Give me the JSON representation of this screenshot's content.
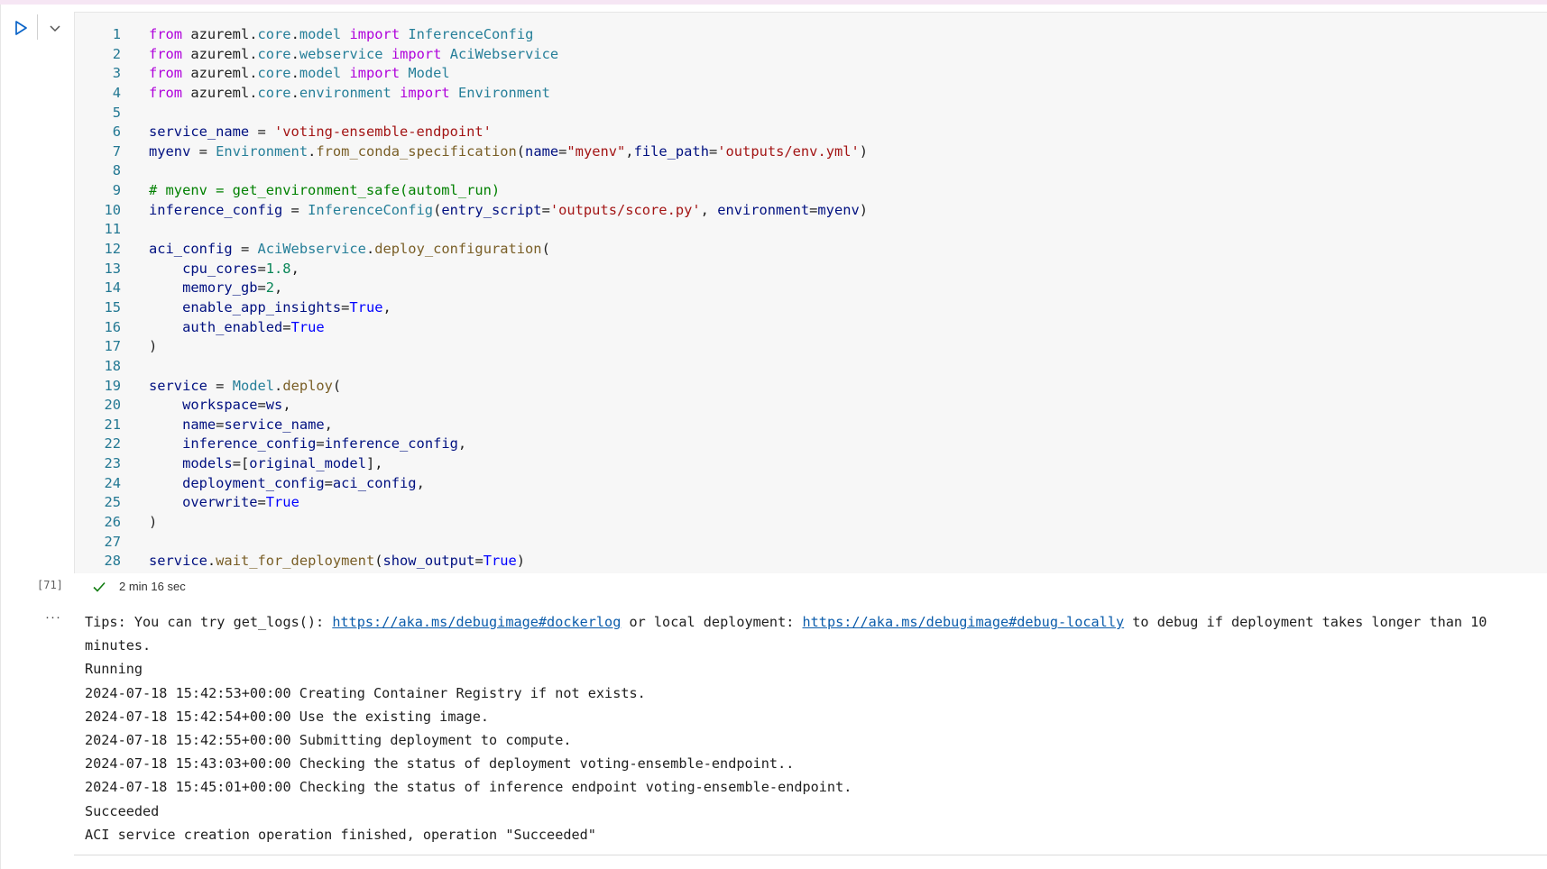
{
  "cell": {
    "execution_count": "[71]",
    "status": "succeeded",
    "duration": "2 min 16 sec",
    "icons": {
      "run": "run-triangle-icon",
      "expand": "chevron-down-icon",
      "status": "check-icon",
      "output_menu": "ellipsis-icon"
    },
    "code_lines": [
      {
        "n": "1",
        "tokens": [
          {
            "t": "from",
            "c": "k"
          },
          {
            "t": " azureml",
            "c": ""
          },
          {
            "t": ".",
            "c": ""
          },
          {
            "t": "core",
            "c": "m"
          },
          {
            "t": ".",
            "c": ""
          },
          {
            "t": "model",
            "c": "m"
          },
          {
            "t": " ",
            "c": ""
          },
          {
            "t": "import",
            "c": "k"
          },
          {
            "t": " InferenceConfig",
            "c": "t"
          }
        ]
      },
      {
        "n": "2",
        "tokens": [
          {
            "t": "from",
            "c": "k"
          },
          {
            "t": " azureml",
            "c": ""
          },
          {
            "t": ".",
            "c": ""
          },
          {
            "t": "core",
            "c": "m"
          },
          {
            "t": ".",
            "c": ""
          },
          {
            "t": "webservice",
            "c": "m"
          },
          {
            "t": " ",
            "c": ""
          },
          {
            "t": "import",
            "c": "k"
          },
          {
            "t": " AciWebservice",
            "c": "t"
          }
        ]
      },
      {
        "n": "3",
        "tokens": [
          {
            "t": "from",
            "c": "k"
          },
          {
            "t": " azureml",
            "c": ""
          },
          {
            "t": ".",
            "c": ""
          },
          {
            "t": "core",
            "c": "m"
          },
          {
            "t": ".",
            "c": ""
          },
          {
            "t": "model",
            "c": "m"
          },
          {
            "t": " ",
            "c": ""
          },
          {
            "t": "import",
            "c": "k"
          },
          {
            "t": " Model",
            "c": "t"
          }
        ]
      },
      {
        "n": "4",
        "tokens": [
          {
            "t": "from",
            "c": "k"
          },
          {
            "t": " azureml",
            "c": ""
          },
          {
            "t": ".",
            "c": ""
          },
          {
            "t": "core",
            "c": "m"
          },
          {
            "t": ".",
            "c": ""
          },
          {
            "t": "environment",
            "c": "m"
          },
          {
            "t": " ",
            "c": ""
          },
          {
            "t": "import",
            "c": "k"
          },
          {
            "t": " Environment",
            "c": "t"
          }
        ]
      },
      {
        "n": "5",
        "tokens": []
      },
      {
        "n": "6",
        "tokens": [
          {
            "t": "service_name",
            "c": "v"
          },
          {
            "t": " = ",
            "c": ""
          },
          {
            "t": "'voting-ensemble-endpoint'",
            "c": "s"
          }
        ]
      },
      {
        "n": "7",
        "tokens": [
          {
            "t": "myenv",
            "c": "v"
          },
          {
            "t": " = ",
            "c": ""
          },
          {
            "t": "Environment",
            "c": "t"
          },
          {
            "t": ".",
            "c": ""
          },
          {
            "t": "from_conda_specification",
            "c": "f"
          },
          {
            "t": "(",
            "c": ""
          },
          {
            "t": "name",
            "c": "v"
          },
          {
            "t": "=",
            "c": ""
          },
          {
            "t": "\"myenv\"",
            "c": "s"
          },
          {
            "t": ",",
            "c": ""
          },
          {
            "t": "file_path",
            "c": "v"
          },
          {
            "t": "=",
            "c": ""
          },
          {
            "t": "'outputs/env.yml'",
            "c": "s"
          },
          {
            "t": ")",
            "c": ""
          }
        ]
      },
      {
        "n": "8",
        "tokens": []
      },
      {
        "n": "9",
        "tokens": [
          {
            "t": "# myenv = get_environment_safe(automl_run)",
            "c": "c"
          }
        ]
      },
      {
        "n": "10",
        "tokens": [
          {
            "t": "inference_config",
            "c": "v"
          },
          {
            "t": " = ",
            "c": ""
          },
          {
            "t": "InferenceConfig",
            "c": "t"
          },
          {
            "t": "(",
            "c": ""
          },
          {
            "t": "entry_script",
            "c": "v"
          },
          {
            "t": "=",
            "c": ""
          },
          {
            "t": "'outputs/score.py'",
            "c": "s"
          },
          {
            "t": ", ",
            "c": ""
          },
          {
            "t": "environment",
            "c": "v"
          },
          {
            "t": "=",
            "c": ""
          },
          {
            "t": "myenv",
            "c": "v"
          },
          {
            "t": ")",
            "c": ""
          }
        ]
      },
      {
        "n": "11",
        "tokens": []
      },
      {
        "n": "12",
        "tokens": [
          {
            "t": "aci_config",
            "c": "v"
          },
          {
            "t": " = ",
            "c": ""
          },
          {
            "t": "AciWebservice",
            "c": "t"
          },
          {
            "t": ".",
            "c": ""
          },
          {
            "t": "deploy_configuration",
            "c": "f"
          },
          {
            "t": "(",
            "c": ""
          }
        ]
      },
      {
        "n": "13",
        "tokens": [
          {
            "t": "    ",
            "c": ""
          },
          {
            "t": "cpu_cores",
            "c": "v"
          },
          {
            "t": "=",
            "c": ""
          },
          {
            "t": "1.8",
            "c": "n"
          },
          {
            "t": ",",
            "c": ""
          }
        ]
      },
      {
        "n": "14",
        "tokens": [
          {
            "t": "    ",
            "c": ""
          },
          {
            "t": "memory_gb",
            "c": "v"
          },
          {
            "t": "=",
            "c": ""
          },
          {
            "t": "2",
            "c": "n"
          },
          {
            "t": ",",
            "c": ""
          }
        ]
      },
      {
        "n": "15",
        "tokens": [
          {
            "t": "    ",
            "c": ""
          },
          {
            "t": "enable_app_insights",
            "c": "v"
          },
          {
            "t": "=",
            "c": ""
          },
          {
            "t": "True",
            "c": "b"
          },
          {
            "t": ",",
            "c": ""
          }
        ]
      },
      {
        "n": "16",
        "tokens": [
          {
            "t": "    ",
            "c": ""
          },
          {
            "t": "auth_enabled",
            "c": "v"
          },
          {
            "t": "=",
            "c": ""
          },
          {
            "t": "True",
            "c": "b"
          }
        ]
      },
      {
        "n": "17",
        "tokens": [
          {
            "t": ")",
            "c": ""
          }
        ]
      },
      {
        "n": "18",
        "tokens": []
      },
      {
        "n": "19",
        "tokens": [
          {
            "t": "service",
            "c": "v"
          },
          {
            "t": " = ",
            "c": ""
          },
          {
            "t": "Model",
            "c": "t"
          },
          {
            "t": ".",
            "c": ""
          },
          {
            "t": "deploy",
            "c": "f"
          },
          {
            "t": "(",
            "c": ""
          }
        ]
      },
      {
        "n": "20",
        "tokens": [
          {
            "t": "    ",
            "c": ""
          },
          {
            "t": "workspace",
            "c": "v"
          },
          {
            "t": "=",
            "c": ""
          },
          {
            "t": "ws",
            "c": "v"
          },
          {
            "t": ",",
            "c": ""
          }
        ]
      },
      {
        "n": "21",
        "tokens": [
          {
            "t": "    ",
            "c": ""
          },
          {
            "t": "name",
            "c": "v"
          },
          {
            "t": "=",
            "c": ""
          },
          {
            "t": "service_name",
            "c": "v"
          },
          {
            "t": ",",
            "c": ""
          }
        ]
      },
      {
        "n": "22",
        "tokens": [
          {
            "t": "    ",
            "c": ""
          },
          {
            "t": "inference_config",
            "c": "v"
          },
          {
            "t": "=",
            "c": ""
          },
          {
            "t": "inference_config",
            "c": "v"
          },
          {
            "t": ",",
            "c": ""
          }
        ]
      },
      {
        "n": "23",
        "tokens": [
          {
            "t": "    ",
            "c": ""
          },
          {
            "t": "models",
            "c": "v"
          },
          {
            "t": "=[",
            "c": ""
          },
          {
            "t": "original_model",
            "c": "v"
          },
          {
            "t": "],",
            "c": ""
          }
        ]
      },
      {
        "n": "24",
        "tokens": [
          {
            "t": "    ",
            "c": ""
          },
          {
            "t": "deployment_config",
            "c": "v"
          },
          {
            "t": "=",
            "c": ""
          },
          {
            "t": "aci_config",
            "c": "v"
          },
          {
            "t": ",",
            "c": ""
          }
        ]
      },
      {
        "n": "25",
        "tokens": [
          {
            "t": "    ",
            "c": ""
          },
          {
            "t": "overwrite",
            "c": "v"
          },
          {
            "t": "=",
            "c": ""
          },
          {
            "t": "True",
            "c": "b"
          }
        ]
      },
      {
        "n": "26",
        "tokens": [
          {
            "t": ")",
            "c": ""
          }
        ]
      },
      {
        "n": "27",
        "tokens": []
      },
      {
        "n": "28",
        "tokens": [
          {
            "t": "service",
            "c": "v"
          },
          {
            "t": ".",
            "c": ""
          },
          {
            "t": "wait_for_deployment",
            "c": "f"
          },
          {
            "t": "(",
            "c": ""
          },
          {
            "t": "show_output",
            "c": "v"
          },
          {
            "t": "=",
            "c": ""
          },
          {
            "t": "True",
            "c": "b"
          },
          {
            "t": ")",
            "c": ""
          }
        ]
      }
    ],
    "output": {
      "tips": {
        "prefix": "Tips: You can try get_logs(): ",
        "link1": "https://aka.ms/debugimage#dockerlog",
        "middle": " or local deployment: ",
        "link2": "https://aka.ms/debugimage#debug-locally",
        "suffix": " to debug if deployment takes longer than 10 minutes."
      },
      "lines": [
        "Running",
        "2024-07-18 15:42:53+00:00 Creating Container Registry if not exists.",
        "2024-07-18 15:42:54+00:00 Use the existing image.",
        "2024-07-18 15:42:55+00:00 Submitting deployment to compute.",
        "2024-07-18 15:43:03+00:00 Checking the status of deployment voting-ensemble-endpoint..",
        "2024-07-18 15:45:01+00:00 Checking the status of inference endpoint voting-ensemble-endpoint.",
        "Succeeded",
        "ACI service creation operation finished, operation \"Succeeded\""
      ]
    }
  }
}
